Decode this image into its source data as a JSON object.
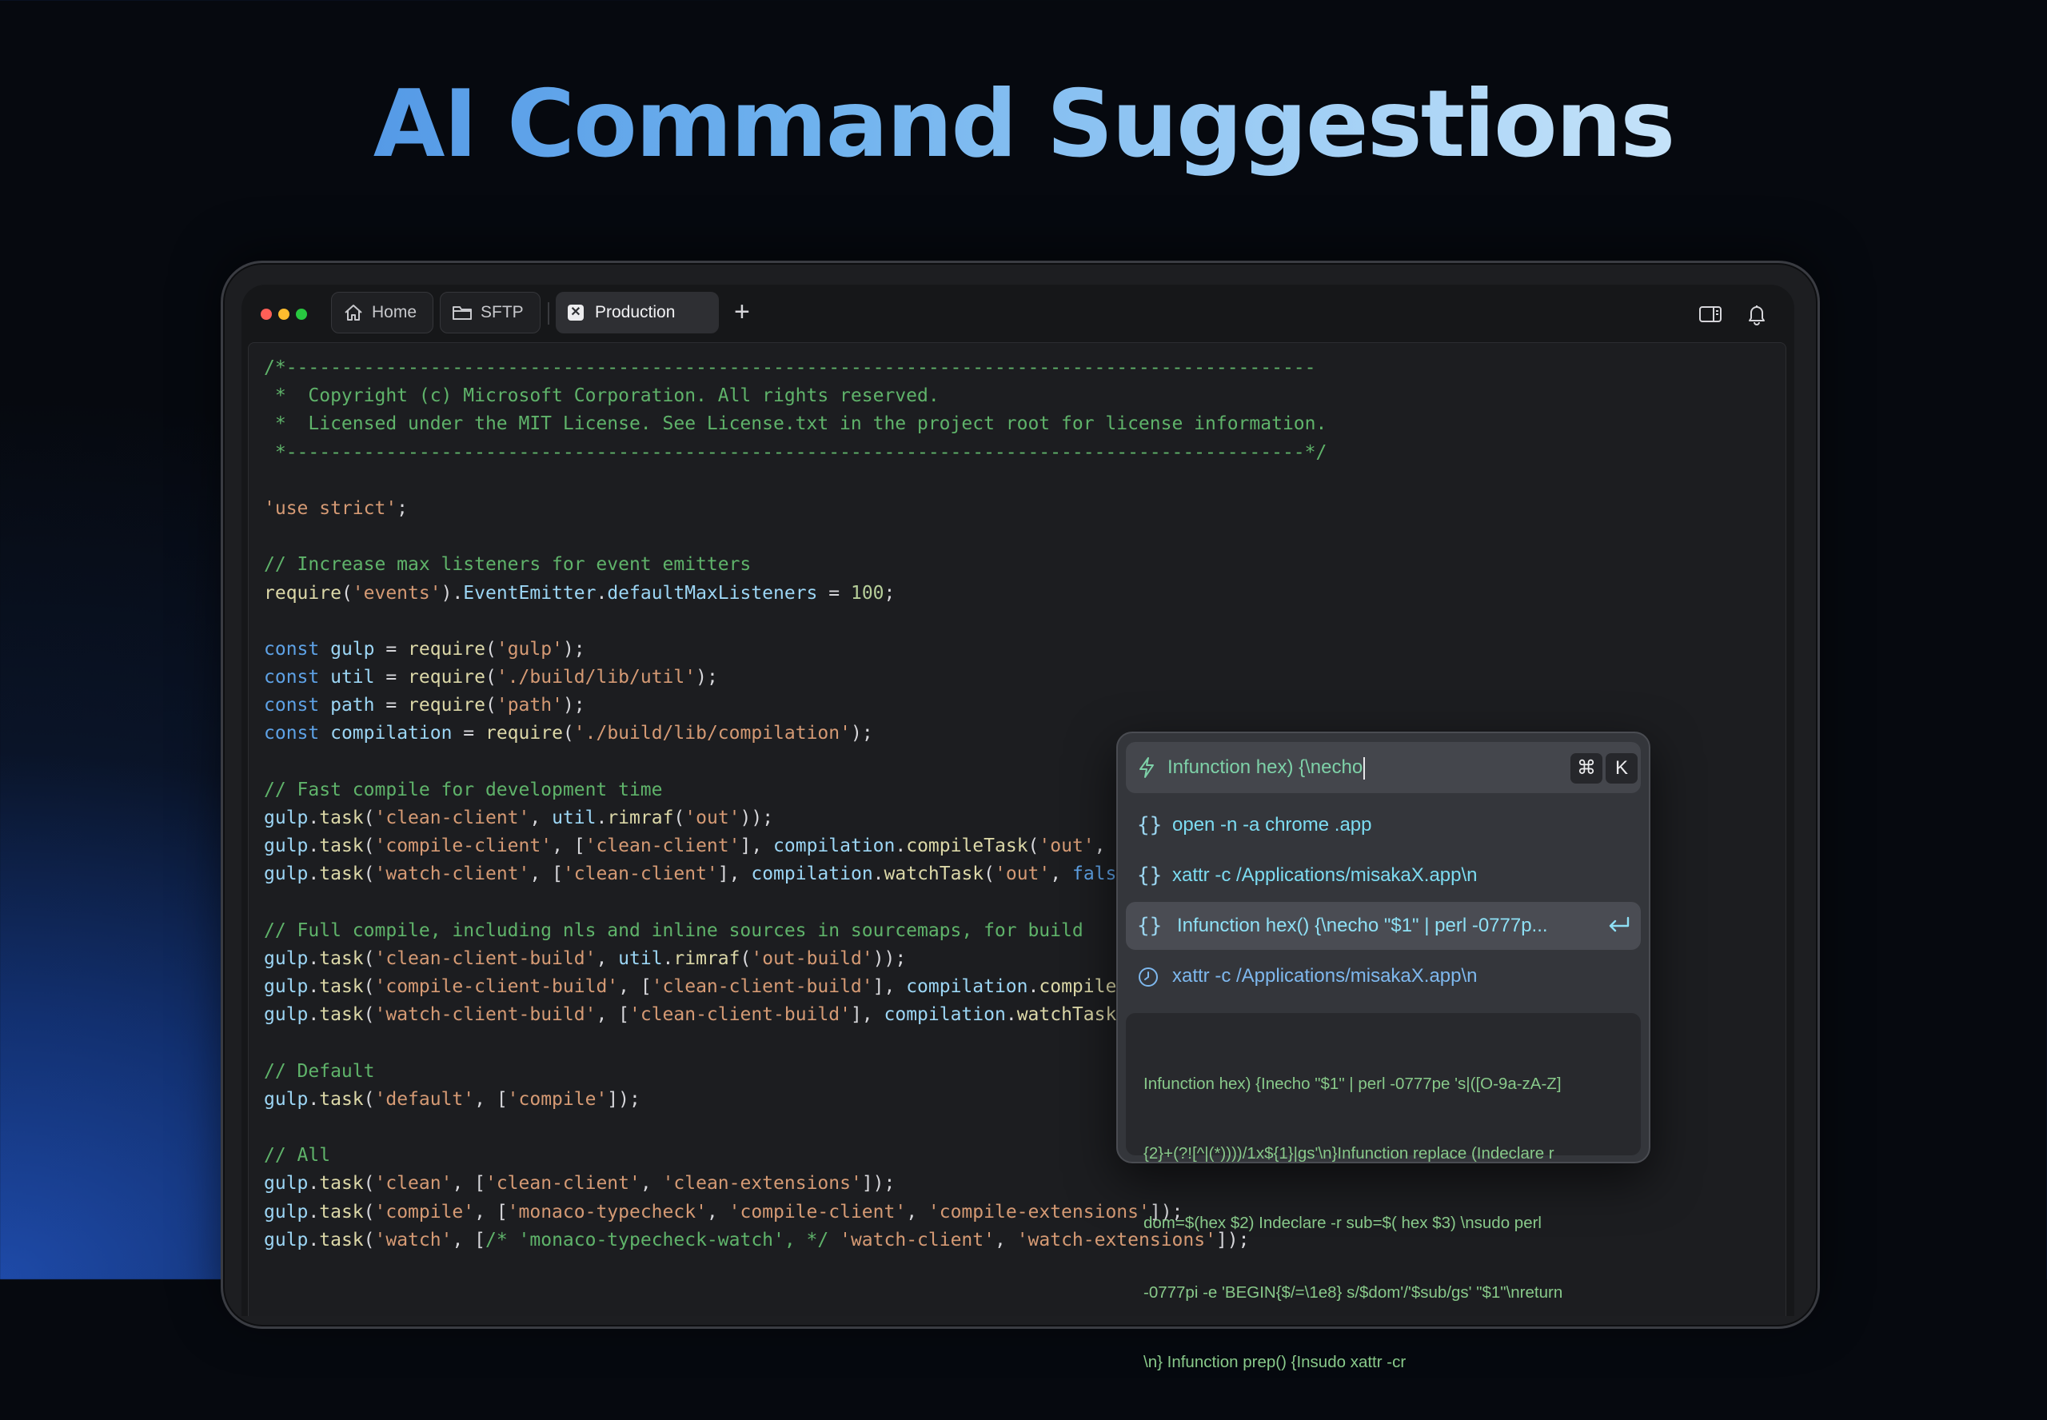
{
  "headline": "AI Command Suggestions",
  "tabs": {
    "home": "Home",
    "sftp": "SFTP",
    "production": "Production",
    "new_tab": "+"
  },
  "window_controls": {
    "close": "#ff5f57",
    "minimize": "#febc2e",
    "maximize": "#28c840"
  },
  "icons": {
    "home": "house-icon",
    "sftp": "folder-icon",
    "tab_close": "close-icon",
    "sidebar": "sidebar-toggle-icon",
    "notifications": "bell-icon",
    "bolt": "lightning-bolt-icon",
    "snippet": "curly-braces-icon",
    "history": "clock-icon",
    "enter": "return-key-icon"
  },
  "code_lines": [
    [
      [
        "c",
        "/*---------------------------------------------------------------------------------------------"
      ]
    ],
    [
      [
        "c",
        " *  Copyright (c) Microsoft Corporation. All rights reserved."
      ]
    ],
    [
      [
        "c",
        " *  Licensed under the MIT License. See License.txt in the project root for license information."
      ]
    ],
    [
      [
        "c",
        " *--------------------------------------------------------------------------------------------*/"
      ]
    ],
    [],
    [
      [
        "s",
        "'use strict'"
      ],
      [
        "p",
        ";"
      ]
    ],
    [],
    [
      [
        "c",
        "// Increase max listeners for event emitters"
      ]
    ],
    [
      [
        "f",
        "require"
      ],
      [
        "p",
        "("
      ],
      [
        "s",
        "'events'"
      ],
      [
        "p",
        ")."
      ],
      [
        "v",
        "EventEmitter"
      ],
      [
        "p",
        "."
      ],
      [
        "v",
        "defaultMaxListeners"
      ],
      [
        "p",
        " = "
      ],
      [
        "n",
        "100"
      ],
      [
        "p",
        ";"
      ]
    ],
    [],
    [
      [
        "k",
        "const"
      ],
      [
        "p",
        " "
      ],
      [
        "v",
        "gulp"
      ],
      [
        "p",
        " = "
      ],
      [
        "f",
        "require"
      ],
      [
        "p",
        "("
      ],
      [
        "s",
        "'gulp'"
      ],
      [
        "p",
        ");"
      ]
    ],
    [
      [
        "k",
        "const"
      ],
      [
        "p",
        " "
      ],
      [
        "v",
        "util"
      ],
      [
        "p",
        " = "
      ],
      [
        "f",
        "require"
      ],
      [
        "p",
        "("
      ],
      [
        "s",
        "'./build/lib/util'"
      ],
      [
        "p",
        ");"
      ]
    ],
    [
      [
        "k",
        "const"
      ],
      [
        "p",
        " "
      ],
      [
        "v",
        "path"
      ],
      [
        "p",
        " = "
      ],
      [
        "f",
        "require"
      ],
      [
        "p",
        "("
      ],
      [
        "s",
        "'path'"
      ],
      [
        "p",
        ");"
      ]
    ],
    [
      [
        "k",
        "const"
      ],
      [
        "p",
        " "
      ],
      [
        "v",
        "compilation"
      ],
      [
        "p",
        " = "
      ],
      [
        "f",
        "require"
      ],
      [
        "p",
        "("
      ],
      [
        "s",
        "'./build/lib/compilation'"
      ],
      [
        "p",
        ");"
      ]
    ],
    [],
    [
      [
        "c",
        "// Fast compile for development time"
      ]
    ],
    [
      [
        "v",
        "gulp"
      ],
      [
        "p",
        "."
      ],
      [
        "f",
        "task"
      ],
      [
        "p",
        "("
      ],
      [
        "s",
        "'clean-client'"
      ],
      [
        "p",
        ", "
      ],
      [
        "v",
        "util"
      ],
      [
        "p",
        "."
      ],
      [
        "f",
        "rimraf"
      ],
      [
        "p",
        "("
      ],
      [
        "s",
        "'out'"
      ],
      [
        "p",
        "));"
      ]
    ],
    [
      [
        "v",
        "gulp"
      ],
      [
        "p",
        "."
      ],
      [
        "f",
        "task"
      ],
      [
        "p",
        "("
      ],
      [
        "s",
        "'compile-client'"
      ],
      [
        "p",
        ", ["
      ],
      [
        "s",
        "'clean-client'"
      ],
      [
        "p",
        "], "
      ],
      [
        "v",
        "compilation"
      ],
      [
        "p",
        "."
      ],
      [
        "f",
        "compileTask"
      ],
      [
        "p",
        "("
      ],
      [
        "s",
        "'out'"
      ],
      [
        "p",
        ", "
      ]
    ],
    [
      [
        "v",
        "gulp"
      ],
      [
        "p",
        "."
      ],
      [
        "f",
        "task"
      ],
      [
        "p",
        "("
      ],
      [
        "s",
        "'watch-client'"
      ],
      [
        "p",
        ", ["
      ],
      [
        "s",
        "'clean-client'"
      ],
      [
        "p",
        "], "
      ],
      [
        "v",
        "compilation"
      ],
      [
        "p",
        "."
      ],
      [
        "f",
        "watchTask"
      ],
      [
        "p",
        "("
      ],
      [
        "s",
        "'out'"
      ],
      [
        "p",
        ", "
      ],
      [
        "k",
        "fals"
      ]
    ],
    [],
    [
      [
        "c",
        "// Full compile, including nls and inline sources in sourcemaps, for build"
      ]
    ],
    [
      [
        "v",
        "gulp"
      ],
      [
        "p",
        "."
      ],
      [
        "f",
        "task"
      ],
      [
        "p",
        "("
      ],
      [
        "s",
        "'clean-client-build'"
      ],
      [
        "p",
        ", "
      ],
      [
        "v",
        "util"
      ],
      [
        "p",
        "."
      ],
      [
        "f",
        "rimraf"
      ],
      [
        "p",
        "("
      ],
      [
        "s",
        "'out-build'"
      ],
      [
        "p",
        "));"
      ]
    ],
    [
      [
        "v",
        "gulp"
      ],
      [
        "p",
        "."
      ],
      [
        "f",
        "task"
      ],
      [
        "p",
        "("
      ],
      [
        "s",
        "'compile-client-build'"
      ],
      [
        "p",
        ", ["
      ],
      [
        "s",
        "'clean-client-build'"
      ],
      [
        "p",
        "], "
      ],
      [
        "v",
        "compilation"
      ],
      [
        "p",
        "."
      ],
      [
        "f",
        "compile"
      ]
    ],
    [
      [
        "v",
        "gulp"
      ],
      [
        "p",
        "."
      ],
      [
        "f",
        "task"
      ],
      [
        "p",
        "("
      ],
      [
        "s",
        "'watch-client-build'"
      ],
      [
        "p",
        ", ["
      ],
      [
        "s",
        "'clean-client-build'"
      ],
      [
        "p",
        "], "
      ],
      [
        "v",
        "compilation"
      ],
      [
        "p",
        "."
      ],
      [
        "f",
        "watchTask"
      ]
    ],
    [],
    [
      [
        "c",
        "// Default"
      ]
    ],
    [
      [
        "v",
        "gulp"
      ],
      [
        "p",
        "."
      ],
      [
        "f",
        "task"
      ],
      [
        "p",
        "("
      ],
      [
        "s",
        "'default'"
      ],
      [
        "p",
        ", ["
      ],
      [
        "s",
        "'compile'"
      ],
      [
        "p",
        "]);"
      ]
    ],
    [],
    [
      [
        "c",
        "// All"
      ]
    ],
    [
      [
        "v",
        "gulp"
      ],
      [
        "p",
        "."
      ],
      [
        "f",
        "task"
      ],
      [
        "p",
        "("
      ],
      [
        "s",
        "'clean'"
      ],
      [
        "p",
        ", ["
      ],
      [
        "s",
        "'clean-client'"
      ],
      [
        "p",
        ", "
      ],
      [
        "s",
        "'clean-extensions'"
      ],
      [
        "p",
        "]);"
      ]
    ],
    [
      [
        "v",
        "gulp"
      ],
      [
        "p",
        "."
      ],
      [
        "f",
        "task"
      ],
      [
        "p",
        "("
      ],
      [
        "s",
        "'compile'"
      ],
      [
        "p",
        ", ["
      ],
      [
        "s",
        "'monaco-typecheck'"
      ],
      [
        "p",
        ", "
      ],
      [
        "s",
        "'compile-client'"
      ],
      [
        "p",
        ", "
      ],
      [
        "s",
        "'compile-extensions'"
      ],
      [
        "p",
        "]);"
      ]
    ],
    [
      [
        "v",
        "gulp"
      ],
      [
        "p",
        "."
      ],
      [
        "f",
        "task"
      ],
      [
        "p",
        "("
      ],
      [
        "s",
        "'watch'"
      ],
      [
        "p",
        ", ["
      ],
      [
        "c",
        "/* 'monaco-typecheck-watch', */"
      ],
      [
        "p",
        " "
      ],
      [
        "s",
        "'watch-client'"
      ],
      [
        "p",
        ", "
      ],
      [
        "s",
        "'watch-extensions'"
      ],
      [
        "p",
        "]);"
      ]
    ]
  ],
  "command_panel": {
    "input_value": "Infunction hex) {\\necho",
    "shortcut_keys": [
      "⌘",
      "K"
    ],
    "suggestions": [
      {
        "label": "open -n -a chrome .app",
        "icon": "curly-braces-icon",
        "selected": false
      },
      {
        "label": "xattr -c /Applications/misakaX.app\\n",
        "icon": "curly-braces-icon",
        "selected": false
      },
      {
        "label": "Infunction hex() {\\necho \"$1\" | perl -0777p...",
        "icon": "curly-braces-icon",
        "selected": true
      },
      {
        "label": "xattr -c /Applications/misakaX.app\\n",
        "icon": "clock-icon",
        "selected": false
      }
    ],
    "preview_lines": [
      "Infunction hex) {Inecho \"$1\" | perl -0777pe 's|([O-9a-zA-Z]",
      "{2}+(?![^|(*))))/1x${1}|gs'\\n}Infunction replace (Indeclare r",
      "dom=$(hex $2) Indeclare -r sub=$( hex $3) \\nsudo perl",
      "-0777pi -e 'BEGIN{$/=\\1e8} s/$dom'/'$sub/gs' \"$1\"\\nreturn",
      "\\n} Infunction prep() {Insudo xattr -cr"
    ]
  }
}
